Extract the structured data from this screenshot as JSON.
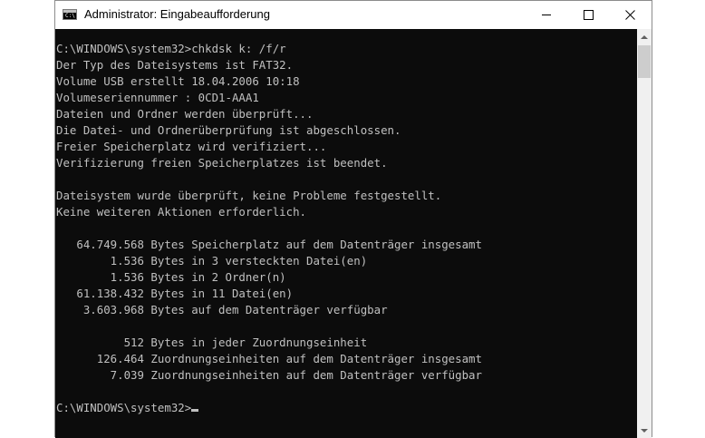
{
  "window": {
    "title": "Administrator: Eingabeaufforderung",
    "icon_name": "cmd-icon",
    "icon_text": "C:\\",
    "controls": {
      "minimize_icon": "minimize-icon",
      "maximize_icon": "maximize-icon",
      "close_glyph": "✕"
    }
  },
  "console": {
    "lines": [
      "C:\\WINDOWS\\system32>chkdsk k: /f/r",
      "Der Typ des Dateisystems ist FAT32.",
      "Volume USB erstellt 18.04.2006 10:18",
      "Volumeseriennummer : 0CD1-AAA1",
      "Dateien und Ordner werden überprüft...",
      "Die Datei- und Ordnerüberprüfung ist abgeschlossen.",
      "Freier Speicherplatz wird verifiziert...",
      "Verifizierung freien Speicherplatzes ist beendet.",
      "",
      "Dateisystem wurde überprüft, keine Probleme festgestellt.",
      "Keine weiteren Aktionen erforderlich.",
      "",
      "   64.749.568 Bytes Speicherplatz auf dem Datenträger insgesamt",
      "        1.536 Bytes in 3 versteckten Datei(en)",
      "        1.536 Bytes in 2 Ordner(n)",
      "   61.138.432 Bytes in 11 Datei(en)",
      "    3.603.968 Bytes auf dem Datenträger verfügbar",
      "",
      "          512 Bytes in jeder Zuordnungseinheit",
      "      126.464 Zuordnungseinheiten auf dem Datenträger insgesamt",
      "        7.039 Zuordnungseinheiten auf dem Datenträger verfügbar",
      ""
    ],
    "prompt": "C:\\WINDOWS\\system32>"
  },
  "colors": {
    "console_bg": "#0c0c0c",
    "console_fg": "#c0c0c0"
  }
}
